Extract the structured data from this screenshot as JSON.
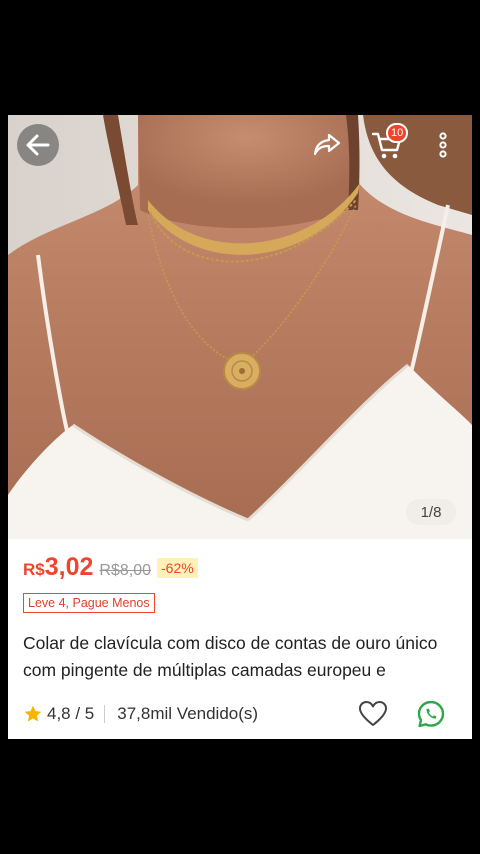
{
  "gallery": {
    "pager": "1/8",
    "cart_count": "10",
    "icons": {
      "back": "arrow-left-icon",
      "share": "share-icon",
      "cart": "cart-icon",
      "more": "more-vertical-icon"
    }
  },
  "product": {
    "currency": "R$",
    "price": "3,02",
    "old_price": "R$8,00",
    "discount": "-62%",
    "promo": "Leve 4, Pague Menos",
    "title": "Colar de clavícula com disco de contas de ouro único com pingente de múltiplas camadas europeu e",
    "rating": "4,8 / 5",
    "sold": "37,8mil Vendido(s)"
  },
  "colors": {
    "accent": "#f0442c",
    "discount_bg": "#fff1b8",
    "whatsapp": "#2aa84a",
    "star": "#f5b400"
  }
}
